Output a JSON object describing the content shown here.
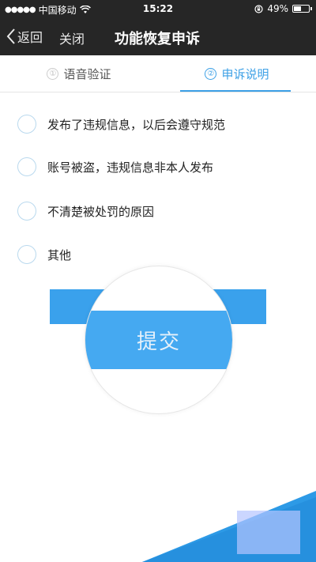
{
  "status_bar": {
    "carrier": "中国移动",
    "time": "15:22",
    "battery_text": "49%",
    "battery_level": 0.49
  },
  "nav": {
    "back_label": "返回",
    "close_label": "关闭",
    "title": "功能恢复申诉"
  },
  "tabs": [
    {
      "number": "①",
      "label": "语音验证"
    },
    {
      "number": "②",
      "label": "申诉说明"
    }
  ],
  "options": [
    {
      "label": "发布了违规信息，以后会遵守规范"
    },
    {
      "label": "账号被盗，违规信息非本人发布"
    },
    {
      "label": "不清楚被处罚的原因"
    },
    {
      "label": "其他"
    }
  ],
  "submit_label": "提交",
  "colors": {
    "header_bg": "#262626",
    "accent": "#3ca0e6",
    "button": "#45a9f1"
  }
}
